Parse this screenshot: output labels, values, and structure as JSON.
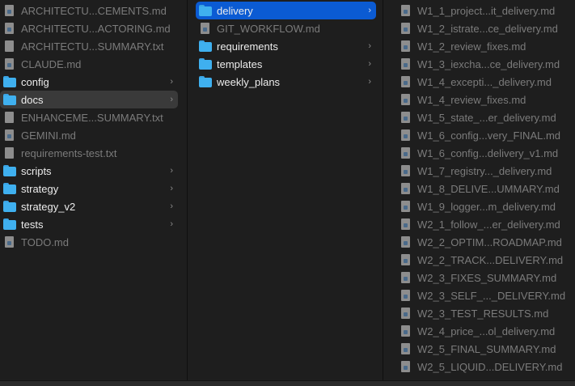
{
  "columns": [
    {
      "items": [
        {
          "name": "ARCHITECTU...CEMENTS.md",
          "type": "md"
        },
        {
          "name": "ARCHITECTU...ACTORING.md",
          "type": "md"
        },
        {
          "name": "ARCHITECTU...SUMMARY.txt",
          "type": "txt"
        },
        {
          "name": "CLAUDE.md",
          "type": "md"
        },
        {
          "name": "config",
          "type": "folder"
        },
        {
          "name": "docs",
          "type": "folder",
          "selected": "inactive"
        },
        {
          "name": "ENHANCEME...SUMMARY.txt",
          "type": "txt"
        },
        {
          "name": "GEMINI.md",
          "type": "md"
        },
        {
          "name": "requirements-test.txt",
          "type": "txt"
        },
        {
          "name": "scripts",
          "type": "folder"
        },
        {
          "name": "strategy",
          "type": "folder"
        },
        {
          "name": "strategy_v2",
          "type": "folder"
        },
        {
          "name": "tests",
          "type": "folder"
        },
        {
          "name": "TODO.md",
          "type": "md"
        }
      ]
    },
    {
      "items": [
        {
          "name": "delivery",
          "type": "folder",
          "selected": "active"
        },
        {
          "name": "GIT_WORKFLOW.md",
          "type": "md"
        },
        {
          "name": "requirements",
          "type": "folder"
        },
        {
          "name": "templates",
          "type": "folder"
        },
        {
          "name": "weekly_plans",
          "type": "folder"
        }
      ]
    },
    {
      "items": [
        {
          "name": "W1_1_project...it_delivery.md",
          "type": "md"
        },
        {
          "name": "W1_2_istrate...ce_delivery.md",
          "type": "md"
        },
        {
          "name": "W1_2_review_fixes.md",
          "type": "md"
        },
        {
          "name": "W1_3_iexcha...ce_delivery.md",
          "type": "md"
        },
        {
          "name": "W1_4_excepti..._delivery.md",
          "type": "md"
        },
        {
          "name": "W1_4_review_fixes.md",
          "type": "md"
        },
        {
          "name": "W1_5_state_...er_delivery.md",
          "type": "md"
        },
        {
          "name": "W1_6_config...very_FINAL.md",
          "type": "md"
        },
        {
          "name": "W1_6_config...delivery_v1.md",
          "type": "md"
        },
        {
          "name": "W1_7_registry..._delivery.md",
          "type": "md"
        },
        {
          "name": "W1_8_DELIVE...UMMARY.md",
          "type": "md"
        },
        {
          "name": "W1_9_logger...m_delivery.md",
          "type": "md"
        },
        {
          "name": "W2_1_follow_...er_delivery.md",
          "type": "md"
        },
        {
          "name": "W2_2_OPTIM...ROADMAP.md",
          "type": "md"
        },
        {
          "name": "W2_2_TRACK...DELIVERY.md",
          "type": "md"
        },
        {
          "name": "W2_3_FIXES_SUMMARY.md",
          "type": "md"
        },
        {
          "name": "W2_3_SELF_..._DELIVERY.md",
          "type": "md"
        },
        {
          "name": "W2_3_TEST_RESULTS.md",
          "type": "md"
        },
        {
          "name": "W2_4_price_...ol_delivery.md",
          "type": "md"
        },
        {
          "name": "W2_5_FINAL_SUMMARY.md",
          "type": "md"
        },
        {
          "name": "W2_5_LIQUID...DELIVERY.md",
          "type": "md"
        }
      ]
    }
  ],
  "chevron": "›",
  "colors": {
    "selection": "#0b5bd3",
    "inactive_selection": "#3a3a3a",
    "folder": "#3fb0ef"
  }
}
